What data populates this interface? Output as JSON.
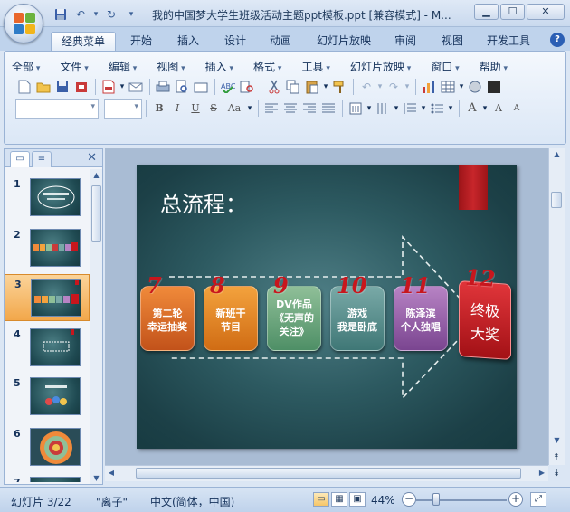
{
  "window": {
    "title": "我的中国梦大学生班级活动主题ppt模板.ppt [兼容模式] - M...",
    "min_label": "▁",
    "max_label": "☐",
    "close_label": "✕"
  },
  "quick_access": {
    "undo_glyph": "↶",
    "redo_glyph": "↻",
    "more_glyph": "▾"
  },
  "tabs": [
    {
      "label": "经典菜单"
    },
    {
      "label": "开始"
    },
    {
      "label": "插入"
    },
    {
      "label": "设计"
    },
    {
      "label": "动画"
    },
    {
      "label": "幻灯片放映"
    },
    {
      "label": "审阅"
    },
    {
      "label": "视图"
    },
    {
      "label": "开发工具"
    }
  ],
  "help_label": "?",
  "menu": [
    {
      "label": "全部"
    },
    {
      "label": "文件"
    },
    {
      "label": "编辑"
    },
    {
      "label": "视图"
    },
    {
      "label": "插入"
    },
    {
      "label": "格式"
    },
    {
      "label": "工具"
    },
    {
      "label": "幻灯片放映"
    },
    {
      "label": "窗口"
    },
    {
      "label": "帮助"
    }
  ],
  "format": {
    "bold": "B",
    "italic": "I",
    "underline": "U",
    "strike": "S",
    "case": "Aa"
  },
  "slides_panel": {
    "close_label": "✕",
    "numbers": [
      "1",
      "2",
      "3",
      "4",
      "5",
      "6",
      "7"
    ],
    "selected": "3"
  },
  "slide": {
    "title": "总流程：",
    "steps": [
      {
        "num": "7",
        "label": "第二轮\n幸运抽奖",
        "color_top": "#f08a3a",
        "color_bottom": "#c2521a"
      },
      {
        "num": "8",
        "label": "新班干\n节目",
        "color_top": "#f3a23d",
        "color_bottom": "#d06c14"
      },
      {
        "num": "9",
        "label": "DV作品\n《无声的\n关注》",
        "color_top": "#8fbf98",
        "color_bottom": "#4e8f66"
      },
      {
        "num": "10",
        "label": "游戏\n我是卧底",
        "color_top": "#79a9a7",
        "color_bottom": "#3f7776"
      },
      {
        "num": "11",
        "label": "陈泽滨\n个人独唱",
        "color_top": "#b783c4",
        "color_bottom": "#7a4590"
      }
    ],
    "final": {
      "num": "12",
      "label": "终极\n大奖"
    }
  },
  "status": {
    "slide_info": "幻灯片 3/22",
    "theme": "\"离子\"",
    "language": "中文(简体，中国)",
    "zoom": "44%",
    "zoom_minus": "−",
    "zoom_plus": "+"
  },
  "colors": {
    "accent": "#c8161d",
    "ribbon": "#dbe7f6",
    "slide_bg": "#2d5a61"
  }
}
